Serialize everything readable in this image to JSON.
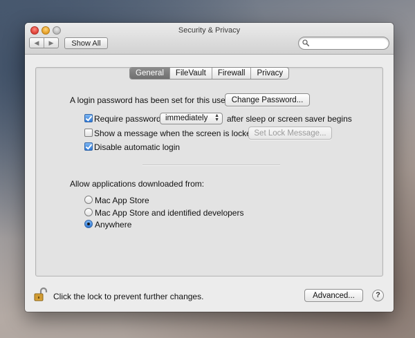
{
  "window": {
    "title": "Security & Privacy",
    "nav_back": "◀",
    "nav_forward": "▶",
    "show_all_label": "Show All",
    "search": {
      "value": "",
      "placeholder": ""
    }
  },
  "tabs": [
    {
      "label": "General",
      "selected": true
    },
    {
      "label": "FileVault",
      "selected": false
    },
    {
      "label": "Firewall",
      "selected": false
    },
    {
      "label": "Privacy",
      "selected": false
    }
  ],
  "general": {
    "password_set_text": "A login password has been set for this user",
    "change_password_label": "Change Password...",
    "require_password": {
      "label": "Require password",
      "checked": true,
      "select_value": "immediately",
      "suffix": "after sleep or screen saver begins"
    },
    "show_message": {
      "label": "Show a message when the screen is locked",
      "checked": false,
      "button_label": "Set Lock Message...",
      "button_enabled": false
    },
    "disable_auto_login": {
      "label": "Disable automatic login",
      "checked": true
    },
    "downloads": {
      "heading": "Allow applications downloaded from:",
      "options": [
        {
          "label": "Mac App Store",
          "selected": false
        },
        {
          "label": "Mac App Store and identified developers",
          "selected": false
        },
        {
          "label": "Anywhere",
          "selected": true
        }
      ]
    }
  },
  "footer": {
    "lock_text": "Click the lock to prevent further changes.",
    "advanced_label": "Advanced...",
    "help_label": "?"
  },
  "colors": {
    "selected_tab": "#7a7a7a",
    "checkbox_accent": "#2f78d6",
    "lock_gold": "#d9a336"
  },
  "icons": {
    "lock": "open-padlock-icon",
    "search": "magnifier-icon",
    "help": "question-mark-icon"
  }
}
